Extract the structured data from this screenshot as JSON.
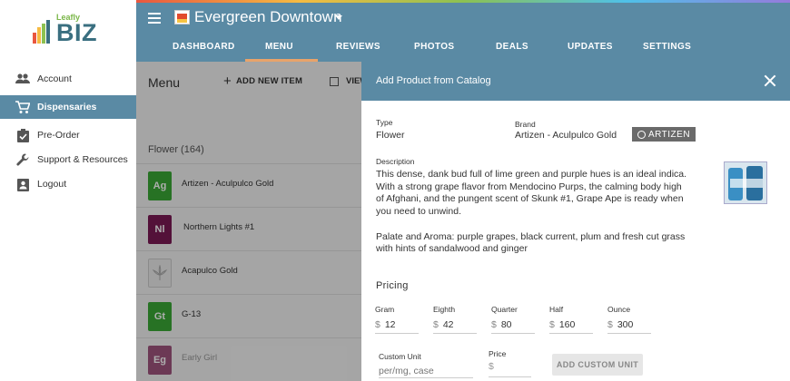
{
  "brand": {
    "leafy": "Leafly",
    "biz": "BIZ",
    "logo_bar_colors": [
      "#e9573f",
      "#f6bb42",
      "#8cc152",
      "#3a6f80"
    ]
  },
  "sidebar": {
    "items": [
      {
        "label": "Account",
        "icon": "people-icon",
        "active": false
      },
      {
        "label": "Dispensaries",
        "icon": "cart-icon",
        "active": true
      },
      {
        "label": "Pre-Order",
        "icon": "clipboard-check-icon",
        "active": false
      },
      {
        "label": "Support & Resources",
        "icon": "wrench-icon",
        "active": false
      },
      {
        "label": "Logout",
        "icon": "badge-icon",
        "active": false
      }
    ]
  },
  "header": {
    "store_name": "Evergreen Downtown",
    "tabs": [
      {
        "label": "DASHBOARD",
        "active": false
      },
      {
        "label": "MENU",
        "active": true
      },
      {
        "label": "REVIEWS",
        "active": false
      },
      {
        "label": "PHOTOS",
        "active": false
      },
      {
        "label": "DEALS",
        "active": false
      },
      {
        "label": "UPDATES",
        "active": false
      },
      {
        "label": "SETTINGS",
        "active": false
      }
    ]
  },
  "menu": {
    "title": "Menu",
    "add_new_item": "ADD NEW ITEM",
    "view_label": "VIEW",
    "section": "Flower (164)",
    "products": [
      {
        "name": "Artizen - Aculpulco Gold",
        "abbr": "Ag",
        "color": "#3aa935"
      },
      {
        "name": "Northern Lights #1",
        "abbr": "Nl",
        "color": "#7b1a55"
      },
      {
        "name": "Acapulco Gold",
        "abbr": "",
        "color": "#e8e8e8"
      },
      {
        "name": "G-13",
        "abbr": "Gt",
        "color": "#3aa935"
      },
      {
        "name": "Early Girl",
        "abbr": "Eg",
        "color": "#a0547e"
      }
    ]
  },
  "modal": {
    "title": "Add Product from Catalog",
    "type_label": "Type",
    "type_value": "Flower",
    "brand_label": "Brand",
    "brand_value": "Artizen - Aculpulco Gold",
    "brand_logo_text": "ARTIZEN",
    "description_label": "Description",
    "description_p1": "This dense, dank bud full of lime green and purple hues is an ideal indica. With a strong grape flavor from Mendocino Purps, the calming body high of Afghani, and the pungent scent of Skunk #1, Grape Ape is ready when you need to unwind.",
    "description_p2": "Palate and Aroma: purple grapes, black current, plum and fresh cut grass with hints of sandalwood and ginger",
    "pricing_title": "Pricing",
    "currency": "$",
    "prices": [
      {
        "label": "Gram",
        "value": "12"
      },
      {
        "label": "Eighth",
        "value": "42"
      },
      {
        "label": "Quarter",
        "value": "80"
      },
      {
        "label": "Half",
        "value": "160"
      },
      {
        "label": "Ounce",
        "value": "300"
      }
    ],
    "custom_unit_label": "Custom Unit",
    "custom_unit_placeholder": "per/mg, case",
    "custom_price_label": "Price",
    "add_custom_unit": "ADD CUSTOM UNIT"
  },
  "colors": {
    "header": "#5a8aa4",
    "accent": "#e8a36a",
    "active_nav": "#5a8aa4"
  }
}
